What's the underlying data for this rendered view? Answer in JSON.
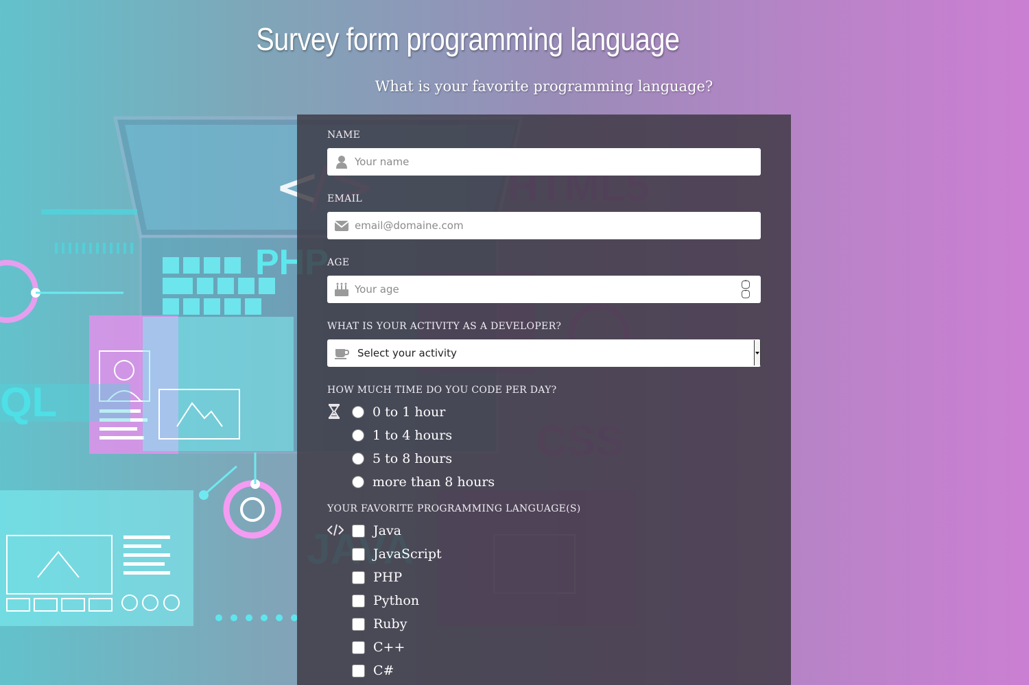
{
  "header": {
    "title": "Survey form programming language",
    "description": "What is your favorite programming language?"
  },
  "form": {
    "name": {
      "label": "NAME",
      "placeholder": "Your name",
      "icon": "user-icon"
    },
    "email": {
      "label": "EMAIL",
      "placeholder": "email@domaine.com",
      "icon": "envelope-icon"
    },
    "age": {
      "label": "AGE",
      "placeholder": "Your age",
      "icon": "birthday-cake-icon"
    },
    "activity": {
      "label": "WHAT IS YOUR ACTIVITY AS A DEVELOPER?",
      "selected": "Select your activity",
      "icon": "coffee-cup-icon"
    },
    "time": {
      "label": "HOW MUCH TIME DO YOU CODE PER DAY?",
      "icon": "hourglass-icon",
      "options": [
        "0 to 1 hour",
        "1 to 4 hours",
        "5 to 8 hours",
        "more than 8 hours"
      ]
    },
    "languages": {
      "label": "YOUR FAVORITE PROGRAMMING LANGUAGE(S)",
      "icon": "code-icon",
      "options": [
        "Java",
        "JavaScript",
        "PHP",
        "Python",
        "Ruby",
        "C++",
        "C#"
      ]
    }
  },
  "background_art": {
    "labels": [
      "HTML5",
      "PHP",
      "CSS",
      "JAVA",
      "QL"
    ]
  },
  "colors": {
    "panel": "#3c3741",
    "accent_pink": "#e77ce6",
    "accent_cyan": "#5ee6ee"
  }
}
